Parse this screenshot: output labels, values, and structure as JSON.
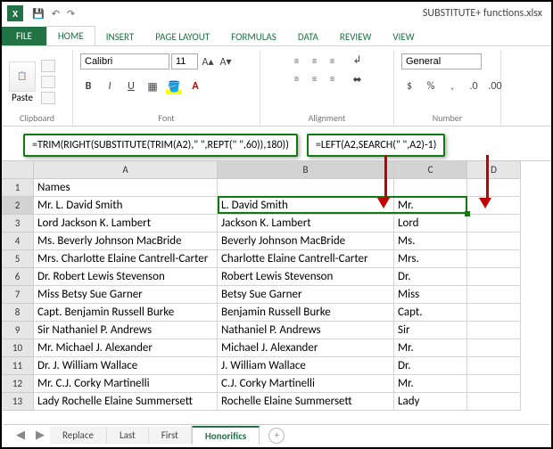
{
  "titlebar": {
    "logo": "X",
    "filename": "SUBSTITUTE+ functions.xlsx"
  },
  "menu": {
    "file": "FILE",
    "home": "HOME",
    "insert": "INSERT",
    "page": "PAGE LAYOUT",
    "formulas": "FORMULAS",
    "data": "DATA",
    "review": "REVIEW",
    "view": "VIEW"
  },
  "ribbon": {
    "paste": "Paste",
    "clipboard": "Clipboard",
    "font_name": "Calibri",
    "font_size": "11",
    "font_label": "Font",
    "alignment": "Alignment",
    "num_format": "General",
    "number": "Number"
  },
  "formulas": {
    "b": "=TRIM(RIGHT(SUBSTITUTE(TRIM(A2),\" \",REPT(\" \",60)),180))",
    "c": "=LEFT(A2,SEARCH(\" \",A2)-1)"
  },
  "cols": {
    "a": "A",
    "b": "B",
    "c": "C",
    "d": "D"
  },
  "header_row": {
    "a": "Names"
  },
  "rows": [
    {
      "n": "2",
      "a": "Mr. L. David Smith",
      "b": "L. David Smith",
      "c": "Mr."
    },
    {
      "n": "3",
      "a": "Lord Jackson K. Lambert",
      "b": "Jackson K. Lambert",
      "c": "Lord"
    },
    {
      "n": "4",
      "a": "Ms. Beverly Johnson MacBride",
      "b": "Beverly Johnson MacBride",
      "c": "Ms."
    },
    {
      "n": "5",
      "a": "Mrs. Charlotte Elaine Cantrell-Carter",
      "b": "Charlotte Elaine Cantrell-Carter",
      "c": "Mrs."
    },
    {
      "n": "6",
      "a": "Dr. Robert Lewis Stevenson",
      "b": "Robert Lewis Stevenson",
      "c": "Dr."
    },
    {
      "n": "7",
      "a": "Miss Betsy Sue Garner",
      "b": "Betsy Sue Garner",
      "c": "Miss"
    },
    {
      "n": "8",
      "a": "Capt. Benjamin Russell Burke",
      "b": "Benjamin Russell Burke",
      "c": "Capt."
    },
    {
      "n": "9",
      "a": "Sir Nathaniel P. Andrews",
      "b": "Nathaniel P. Andrews",
      "c": "Sir"
    },
    {
      "n": "10",
      "a": "Mr. Michael J. Alexander",
      "b": "Michael J. Alexander",
      "c": "Mr."
    },
    {
      "n": "11",
      "a": "Dr. J. William Wallace",
      "b": "J. William Wallace",
      "c": "Dr."
    },
    {
      "n": "12",
      "a": "Mr. C.J. Corky Martinelli",
      "b": "C.J. Corky Martinelli",
      "c": "Mr."
    },
    {
      "n": "13",
      "a": "Lady Rochelle Elaine Summersett",
      "b": "Rochelle Elaine Summersett",
      "c": "Lady"
    }
  ],
  "sheets": {
    "s1": "Replace",
    "s2": "Last",
    "s3": "First",
    "s4": "Honorifics"
  }
}
